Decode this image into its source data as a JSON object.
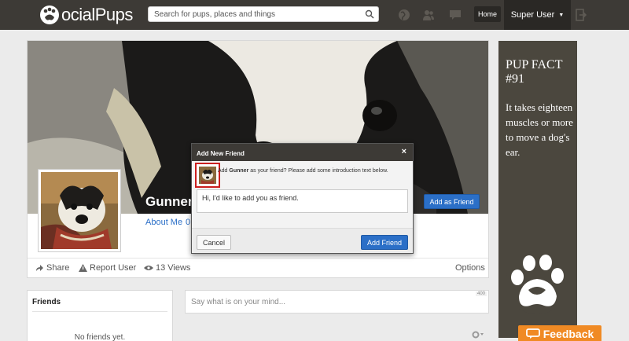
{
  "navbar": {
    "logo_text": "ocialPups",
    "search_placeholder": "Search for pups, places and things",
    "home_label": "Home",
    "user_label": "Super User",
    "icons": [
      "globe-icon",
      "friends-icon",
      "messages-icon",
      "logout-icon"
    ]
  },
  "profile": {
    "name": "Gunner",
    "add_friend_label": "Add as Friend",
    "about_label": "About Me",
    "about_count": "0",
    "actions": {
      "share": "Share",
      "report": "Report User",
      "views": "13 Views",
      "options": "Options"
    }
  },
  "modal": {
    "title": "Add New Friend",
    "close": "×",
    "prompt_prefix": "Add ",
    "prompt_name": "Gunner",
    "prompt_suffix": " as your friend? Please add some introduction text below.",
    "message": "Hi, I'd like to add you as friend.",
    "cancel_label": "Cancel",
    "add_label": "Add Friend"
  },
  "friends_panel": {
    "title": "Friends",
    "empty": "No friends yet."
  },
  "post_box": {
    "placeholder": "Say what is on your mind...",
    "char_count": "400"
  },
  "pup_fact": {
    "title": "PUP FACT #91",
    "body": "It takes eighteen muscles or more to move a dog's ear."
  },
  "feedback_label": "Feedback",
  "colors": {
    "navbar": "#3d3a36",
    "primary_button": "#2b6fc7",
    "fact_panel": "#4b473e",
    "feedback": "#f08a24",
    "highlight": "#cc1f1f"
  }
}
